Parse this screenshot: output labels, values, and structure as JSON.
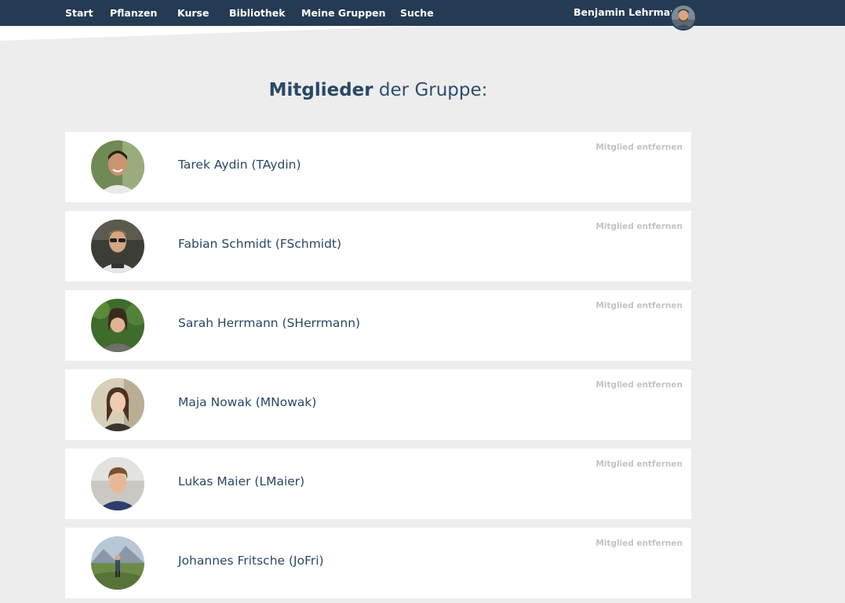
{
  "nav": {
    "items": [
      "Start",
      "Pflanzen",
      "Kurse",
      "Bibliothek",
      "Meine Gruppen",
      "Suche"
    ],
    "user_name": "Benjamin Lehrmann"
  },
  "heading": {
    "bold": "Mitglieder",
    "rest": "der Gruppe:"
  },
  "members": [
    {
      "name": "Tarek Aydin (TAydin)",
      "remove_label": "Mitglied entfernen"
    },
    {
      "name": "Fabian Schmidt (FSchmidt)",
      "remove_label": "Mitglied entfernen"
    },
    {
      "name": "Sarah Herrmann (SHerrmann)",
      "remove_label": "Mitglied entfernen"
    },
    {
      "name": "Maja Nowak (MNowak)",
      "remove_label": "Mitglied entfernen"
    },
    {
      "name": "Lukas Maier (LMaier)",
      "remove_label": "Mitglied entfernen"
    },
    {
      "name": "Johannes Fritsche (JoFri)",
      "remove_label": "Mitglied entfernen"
    }
  ],
  "colors": {
    "navbar": "#253a53",
    "page_background": "#ededed",
    "card_background": "#ffffff",
    "text_primary": "#2a4766",
    "remove_link": "#c3c3c3"
  }
}
